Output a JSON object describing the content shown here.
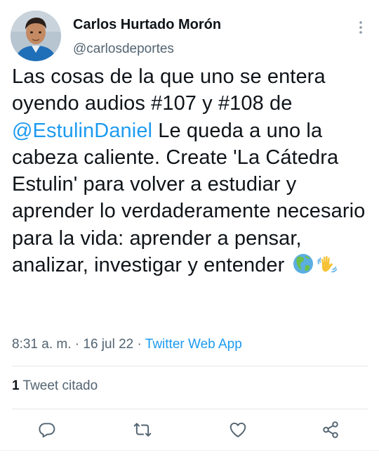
{
  "author": {
    "name": "Carlos Hurtado Morón",
    "handle": "@carlosdeportes"
  },
  "tweet": {
    "text_before_mention": "Las cosas de la que uno se entera oyendo audios #107 y #108 de ",
    "mention": "@EstulinDaniel",
    "text_after_mention": " Le queda a uno la cabeza caliente. Create 'La Cátedra Estulin' para volver a estudiar y aprender lo verdaderamente necesario para la vida: aprender a pensar, analizar, investigar y entender ",
    "emojis": [
      "globe-americas-icon",
      "waving-hand-icon"
    ]
  },
  "meta": {
    "time": "8:31 a. m.",
    "separator_1": " · ",
    "date": "16 jul 22",
    "separator_2": " · ",
    "source": "Twitter Web App"
  },
  "stats": {
    "quote_count": "1",
    "quote_label": " Tweet citado"
  },
  "actions": {
    "reply": "reply-icon",
    "retweet": "retweet-icon",
    "like": "like-icon",
    "share": "share-icon"
  },
  "colors": {
    "accent": "#1d9bf0",
    "text": "#0f1419",
    "secondary": "#536471",
    "divider": "#e2e6e9"
  }
}
